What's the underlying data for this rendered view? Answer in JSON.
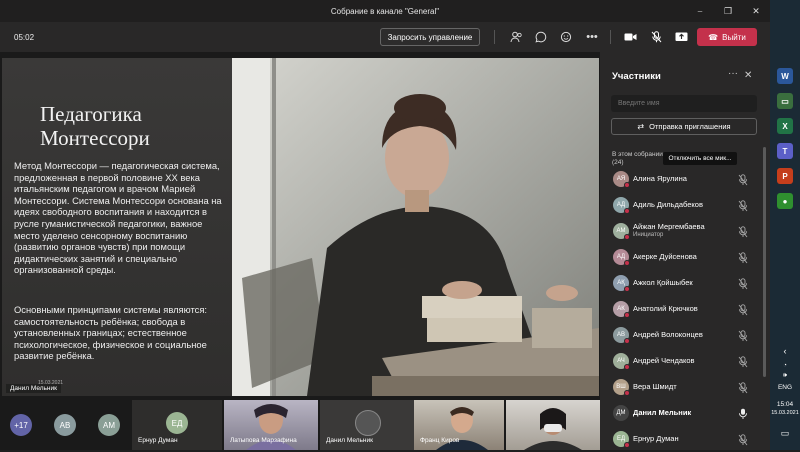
{
  "window": {
    "title": "Собрание в канале \"General\"",
    "controls": [
      "⎯",
      "❐",
      "✕"
    ],
    "pin_icon": "⇲"
  },
  "toolbar": {
    "timer": "05:02",
    "request_control": "Запросить управление",
    "leave": "Выйти"
  },
  "slide": {
    "title": "Педагогика Монтессори",
    "paragraph1": "Метод Монтессори — педагогическая система, предложенная в первой половине XX века итальянским педагогом и врачом Марией Монтессори. Система Монтессори основана на идеях свободного воспитания и находится в русле гуманистической педагогики, важное место уделено сенсорному воспитанию (развитию органов чувств) при помощи дидактических занятий и специально организованной среды.",
    "paragraph2": "Основными принципами системы являются: самостоятельность ребёнка; свобода в установленных границах; естественное психологическое, физическое и социальное развитие ребёнка.",
    "date": "15.03.2021",
    "presenter": "Данил Мельник"
  },
  "bottom": {
    "overflow": "+17",
    "avatars": [
      {
        "initials": "АВ",
        "color": "#8a9b9e"
      },
      {
        "initials": "АМ",
        "color": "#8a9f96"
      }
    ],
    "tiles": [
      {
        "initials": "ЕД",
        "name": "Ернур Думан",
        "color": "#9bb593"
      },
      {
        "name": "Латыпова Марзафина"
      },
      {
        "name": "Данил Мельник"
      },
      {
        "name": "Франц Киров"
      },
      {
        "name": ""
      }
    ]
  },
  "panel": {
    "title": "Участники",
    "search_placeholder": "Введите имя",
    "invite": "Отправка приглашения",
    "section": "В этом собрании",
    "count": "(24)",
    "tooltip": "Отключить все мик...",
    "participants": [
      {
        "initials": "АЯ",
        "name": "Алина Ярулина",
        "color": "#a98a86",
        "muted": true
      },
      {
        "initials": "АД",
        "name": "Адиль Дильдабеков",
        "color": "#8fa7ab",
        "muted": true
      },
      {
        "initials": "АМ",
        "name": "Айжан Мергембаева",
        "role": "Инициатор",
        "color": "#9fb09e",
        "muted": true
      },
      {
        "initials": "АД",
        "name": "Акерке Дуйсенова",
        "color": "#b48a96",
        "muted": true
      },
      {
        "initials": "АҚ",
        "name": "Ажкол Қойшыбек",
        "color": "#8f9fb0",
        "muted": true
      },
      {
        "initials": "АК",
        "name": "Анатолий Крючков",
        "color": "#b59ea6",
        "muted": true
      },
      {
        "initials": "АВ",
        "name": "Андрей Волоконцев",
        "color": "#8c9b9e",
        "muted": true
      },
      {
        "initials": "АЧ",
        "name": "Андрей Чендаков",
        "color": "#9faf9a",
        "muted": true
      },
      {
        "initials": "ВШ",
        "name": "Вера Шмидт",
        "color": "#b3a08a",
        "muted": true
      },
      {
        "initials": "ДМ",
        "name": "Данил Мельник",
        "color": "#444",
        "muted": false,
        "bold": true
      },
      {
        "initials": "ЕД",
        "name": "Ернур Думан",
        "color": "#9bb593",
        "muted": true
      }
    ]
  },
  "taskbar": {
    "apps": [
      {
        "label": "W",
        "color": "#2b579a",
        "name": "word-app-icon"
      },
      {
        "label": "▭",
        "color": "#3a6e3e",
        "name": "app-icon"
      },
      {
        "label": "X",
        "color": "#217346",
        "name": "excel-app-icon"
      },
      {
        "label": "T",
        "color": "#5b5fc7",
        "name": "teams-app-icon"
      },
      {
        "label": "P",
        "color": "#c43e1c",
        "name": "powerpoint-app-icon"
      },
      {
        "label": "●",
        "color": "#2f8f2f",
        "name": "chrome-app-icon"
      }
    ],
    "lang": "ENG",
    "time": "15:04",
    "date": "15.03.2021"
  }
}
